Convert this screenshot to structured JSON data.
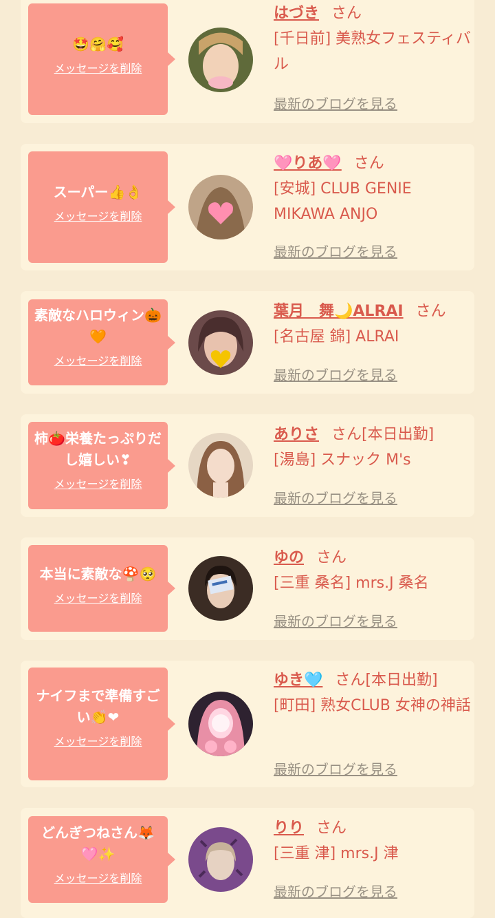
{
  "delete_label": "メッセージを削除",
  "blog_label": "最新のブログを見る",
  "san_label": "さん",
  "colors": {
    "page_bg": "#f8ecd4",
    "card_bg": "#fdf3dc",
    "bubble_bg": "#fa9b8e",
    "accent_text": "#d95a4d",
    "muted_link": "#999184"
  },
  "entries": [
    {
      "message": "🤩🤗🥰",
      "name": "はづき",
      "status": "",
      "shop": "[千日前] 美熟女フェスティバル"
    },
    {
      "message": "スーパー👍👌",
      "name": "🩷りあ🩷",
      "status": "",
      "shop": "[安城] CLUB GENIE MIKAWA ANJO"
    },
    {
      "message": "素敵なハロウィン🎃🧡",
      "name": "葉月　舞🌙ALRAI",
      "status": "",
      "shop": "[名古屋 錦] ALRAI"
    },
    {
      "message": "柿🍅栄養たっぷりだし嬉しい❣",
      "name": "ありさ",
      "status": "[本日出勤]",
      "shop": "[湯島] スナック M's"
    },
    {
      "message": "本当に素敵な🍄🥺",
      "name": "ゆの",
      "status": "",
      "shop": "[三重 桑名] mrs.J 桑名"
    },
    {
      "message": "ナイフまで準備すごい👏❤",
      "name": "ゆき🩵",
      "status": "[本日出勤]",
      "shop": "[町田] 熟女CLUB 女神の神話"
    },
    {
      "message": "どんぎつねさん🦊🩷✨",
      "name": "りり",
      "status": "",
      "shop": "[三重 津] mrs.J 津"
    }
  ]
}
